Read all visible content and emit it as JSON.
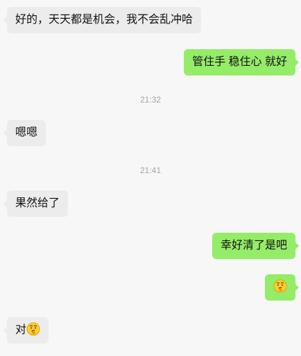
{
  "messages": [
    {
      "side": "incoming",
      "text": "好的，天天都是机会，我不会乱冲哈"
    },
    {
      "side": "outgoing",
      "text": "管住手 稳住心 就好"
    },
    {
      "type": "time",
      "text": "21:32"
    },
    {
      "side": "incoming",
      "text": "嗯嗯"
    },
    {
      "type": "time",
      "text": "21:41"
    },
    {
      "side": "incoming",
      "text": "果然给了"
    },
    {
      "side": "outgoing",
      "text": "幸好清了是吧"
    },
    {
      "side": "outgoing",
      "emoji": "thinking-face-emoji"
    },
    {
      "side": "incoming",
      "text": "对",
      "emoji": "thinking-face-emoji"
    }
  ],
  "colors": {
    "background": "#f7f7f7",
    "incoming_bubble": "#ececec",
    "outgoing_bubble": "#95ec69",
    "timestamp_text": "#a3a3a3"
  }
}
